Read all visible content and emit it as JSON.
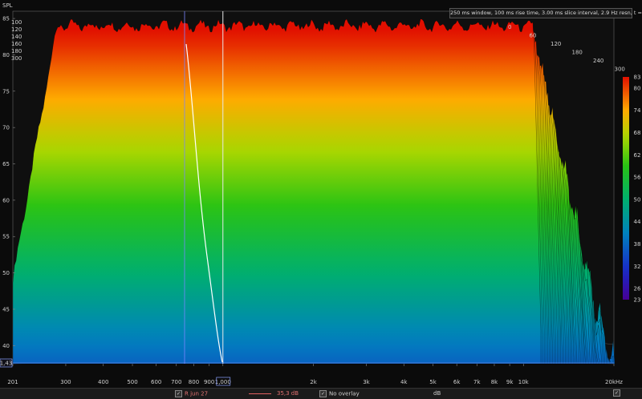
{
  "chart_data": {
    "type": "waterfall",
    "ylabel": "SPL",
    "xunit": "Hz",
    "info": "250 ms window, 100 ms rise time, 3.00 ms slice interval, 2.9 Hz resn, t = 300 ms",
    "y_ticks": [
      "85",
      "80",
      "75",
      "70",
      "65",
      "60",
      "55",
      "50",
      "45",
      "40"
    ],
    "ylim": [
      37.5,
      86
    ],
    "x_ticks": [
      {
        "f": 200,
        "label": "201"
      },
      {
        "f": 300,
        "label": "300"
      },
      {
        "f": 400,
        "label": "400"
      },
      {
        "f": 500,
        "label": "500"
      },
      {
        "f": 600,
        "label": "600"
      },
      {
        "f": 700,
        "label": "700"
      },
      {
        "f": 800,
        "label": "800"
      },
      {
        "f": 900,
        "label": "900"
      },
      {
        "f": 1000,
        "label": "1,000"
      },
      {
        "f": 2000,
        "label": "2k"
      },
      {
        "f": 3000,
        "label": "3k"
      },
      {
        "f": 4000,
        "label": "4k"
      },
      {
        "f": 5000,
        "label": "5k"
      },
      {
        "f": 6000,
        "label": "6k"
      },
      {
        "f": 7000,
        "label": "7k"
      },
      {
        "f": 8000,
        "label": "8k"
      },
      {
        "f": 9000,
        "label": "9k"
      },
      {
        "f": 10000,
        "label": "10k"
      },
      {
        "f": 20000,
        "label": "20kHz"
      }
    ],
    "xlim": [
      200,
      20000
    ],
    "time_ticks_ms": [
      "0",
      "60",
      "120",
      "180",
      "240",
      "300"
    ],
    "time_ticks_left": [
      "100",
      "120",
      "140",
      "160",
      "180",
      "300"
    ],
    "colorbar_ticks": [
      "83",
      "80",
      "74",
      "68",
      "62",
      "56",
      "50",
      "44",
      "38",
      "32",
      "26",
      "23"
    ],
    "colorbar_range": [
      23,
      83
    ],
    "cursor_value": "1.00",
    "cursor_y_value": "1,43",
    "slices": 100,
    "front_peak_db": 84,
    "back_floor_db": 38
  },
  "statusbar": {
    "measurement": "R jun 27",
    "level": "35,3 dB",
    "overlay": "No overlay",
    "unit": "dB"
  }
}
